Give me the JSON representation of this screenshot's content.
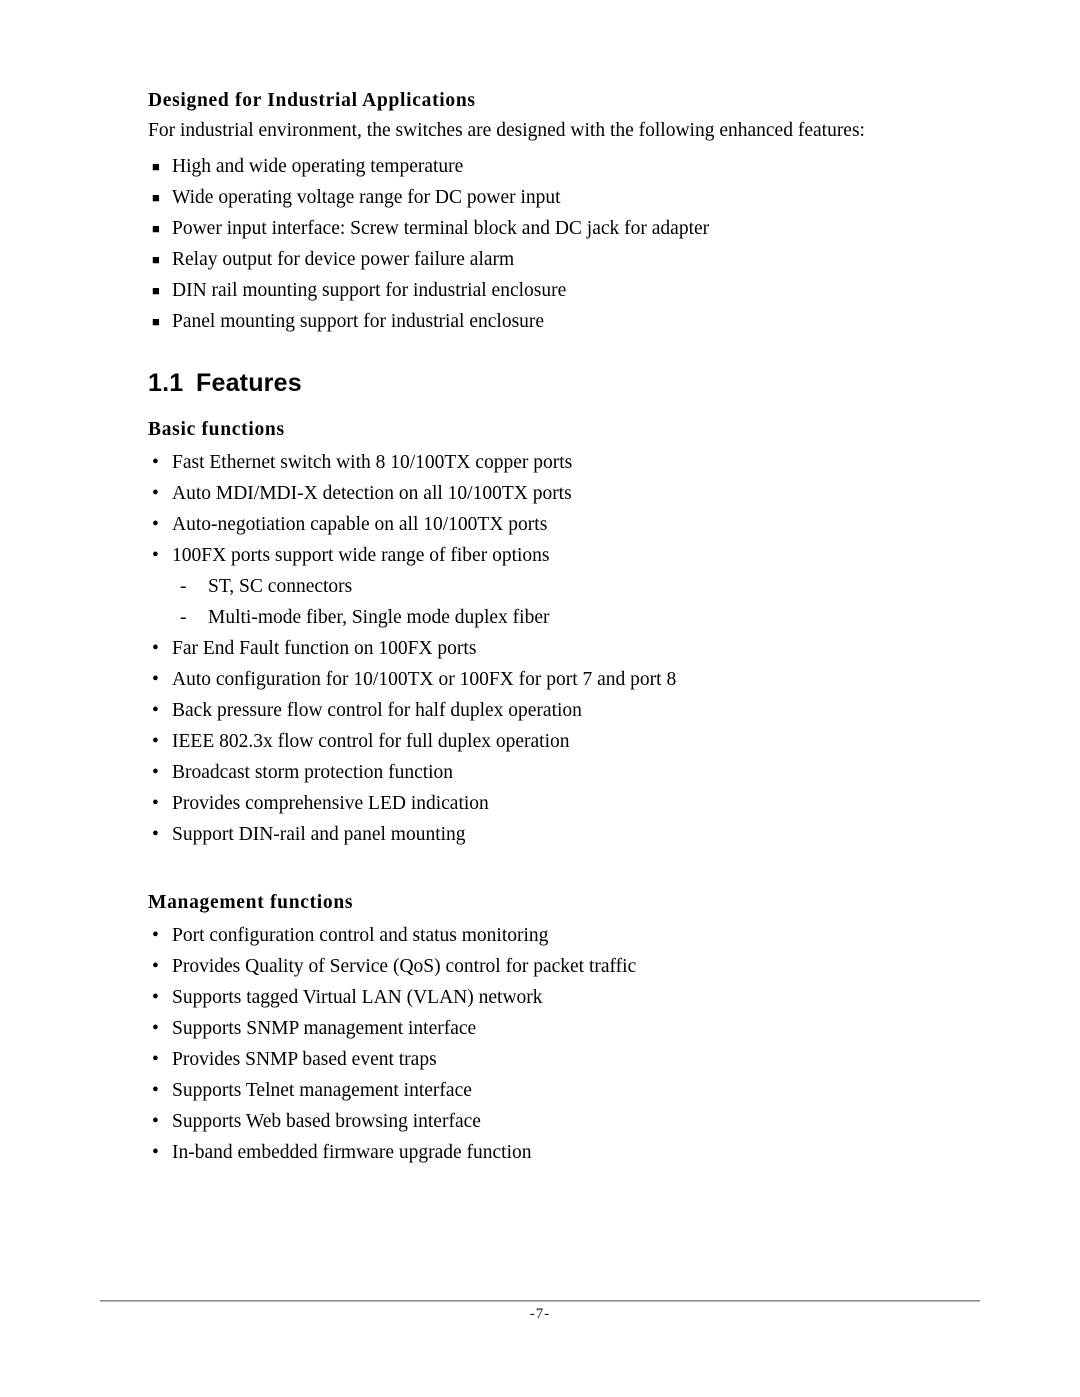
{
  "document": {
    "intro_section": {
      "heading": "Designed for Industrial Applications",
      "intro_text": "For industrial environment, the switches are designed with the following enhanced features:",
      "bullet_marker": "■",
      "items": [
        "High and wide operating temperature",
        "Wide operating voltage range for DC power input",
        "Power input interface: Screw terminal block and DC jack for adapter",
        "Relay output for device power failure alarm",
        "DIN rail mounting support for industrial enclosure",
        "Panel mounting support for industrial enclosure"
      ]
    },
    "features_section": {
      "number": "1.1",
      "title": "Features",
      "bullet_marker": "•",
      "sub_marker": "-",
      "basic": {
        "heading": "Basic functions",
        "items_before_sub": [
          "Fast Ethernet switch with 8 10/100TX copper ports",
          "Auto MDI/MDI-X detection on all 10/100TX ports",
          "Auto-negotiation capable on all 10/100TX ports",
          "100FX ports support wide range of fiber options"
        ],
        "sub_items": [
          "ST, SC connectors",
          "Multi-mode fiber, Single mode duplex fiber"
        ],
        "items_after_sub": [
          "Far End Fault function on 100FX ports",
          "Auto configuration for 10/100TX or 100FX for port 7 and port 8",
          "Back pressure flow control for half duplex operation",
          "IEEE 802.3x flow control for full duplex operation",
          "Broadcast storm protection function",
          "Provides comprehensive LED indication",
          "Support DIN-rail and panel mounting"
        ]
      },
      "management": {
        "heading": "Management functions",
        "items": [
          "Port configuration control and status monitoring",
          "Provides Quality of Service (QoS) control for packet traffic",
          "Supports tagged Virtual LAN (VLAN) network",
          "Supports SNMP management interface",
          "Provides SNMP based event traps",
          "Supports Telnet management interface",
          "Supports Web based browsing interface",
          "In-band embedded firmware upgrade function"
        ]
      }
    },
    "footer": {
      "page_number": "-7-"
    }
  }
}
